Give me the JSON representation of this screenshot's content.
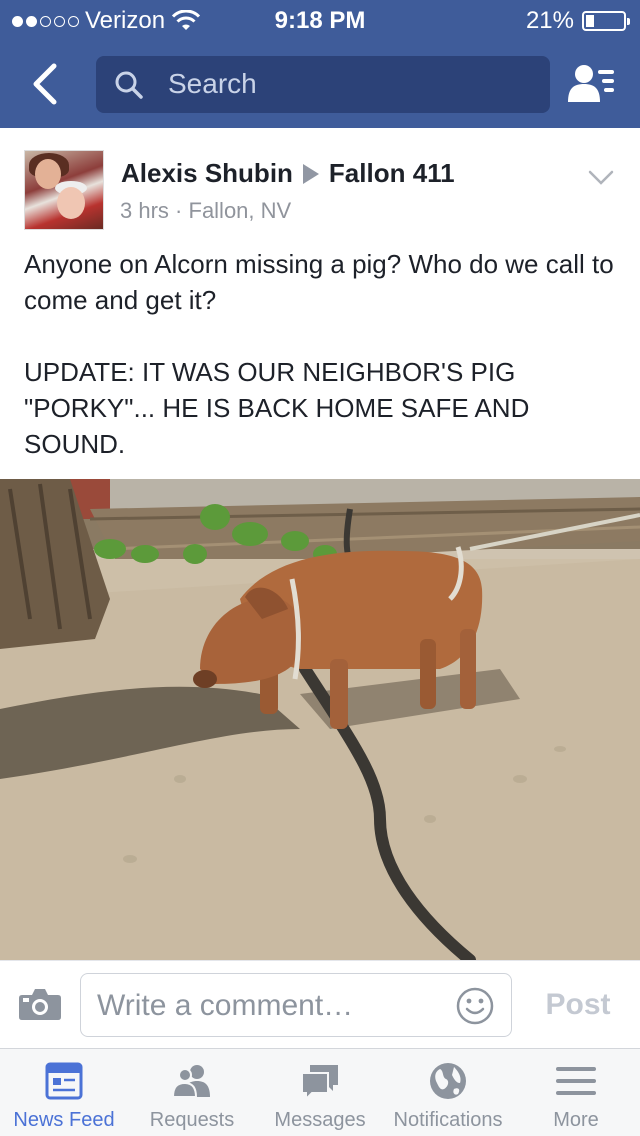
{
  "status_bar": {
    "carrier": "Verizon",
    "signal_bars_filled": 2,
    "signal_bars_total": 5,
    "time": "9:18 PM",
    "battery": "21%",
    "battery_level": 0.21
  },
  "nav": {
    "search_placeholder": "Search"
  },
  "post": {
    "author": "Alexis Shubin",
    "group": "Fallon 411",
    "time_ago": "3 hrs",
    "separator": "·",
    "location": "Fallon, NV",
    "paragraphs": [
      "Anyone on Alcorn missing a pig? Who do we call to come and get it?",
      "UPDATE:  IT WAS OUR NEIGHBOR'S PIG \"PORKY\"... HE IS BACK HOME SAFE AND SOUND."
    ]
  },
  "comment_bar": {
    "placeholder": "Write a comment…",
    "post_label": "Post"
  },
  "tabs": [
    {
      "label": "News Feed",
      "icon": "news-feed-icon",
      "active": true
    },
    {
      "label": "Requests",
      "icon": "requests-icon",
      "active": false
    },
    {
      "label": "Messages",
      "icon": "messages-icon",
      "active": false
    },
    {
      "label": "Notifications",
      "icon": "notifications-icon",
      "active": false
    },
    {
      "label": "More",
      "icon": "more-icon",
      "active": false
    }
  ],
  "colors": {
    "brand_blue": "#3f5c9a",
    "active_tab": "#4b72d6",
    "inactive_tab": "#8d949e"
  }
}
